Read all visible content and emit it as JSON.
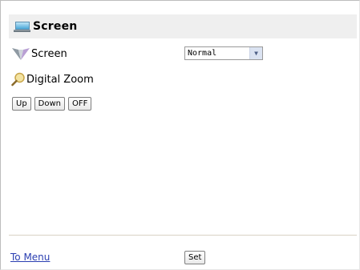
{
  "header": {
    "title": "Screen",
    "icon": "monitor-icon"
  },
  "screen_setting": {
    "label": "Screen",
    "icon": "screen-icon",
    "selected": "Normal"
  },
  "digital_zoom": {
    "label": "Digital Zoom",
    "icon": "magnifier-icon",
    "buttons": [
      "Up",
      "Down",
      "OFF"
    ]
  },
  "footer": {
    "menu_link": "To Menu",
    "set_label": "Set"
  },
  "colors": {
    "header_bg": "#efefef",
    "link": "#2a3eb1"
  }
}
